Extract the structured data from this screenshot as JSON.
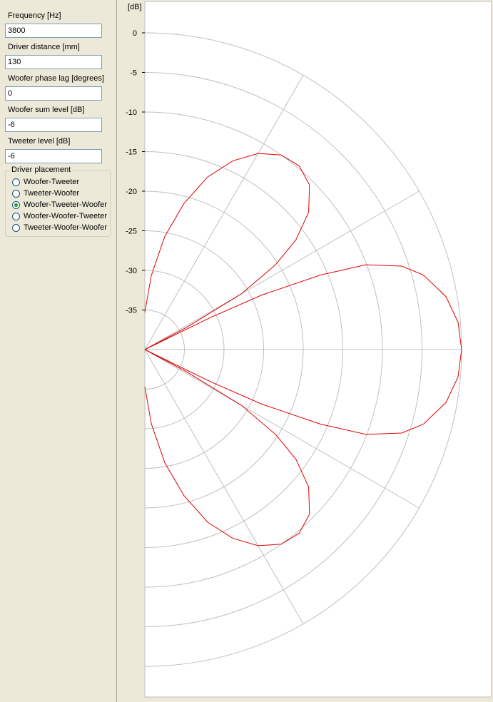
{
  "controls": {
    "frequency": {
      "label": "Frequency [Hz]",
      "value": "3800"
    },
    "driver_distance": {
      "label": "Driver distance [mm]",
      "value": "130"
    },
    "woofer_phase_lag": {
      "label": "Woofer phase lag [degrees]",
      "value": "0"
    },
    "woofer_sum_level": {
      "label": "Woofer sum level [dB]",
      "value": "-6"
    },
    "tweeter_level": {
      "label": "Tweeter level [dB]",
      "value": "-6"
    }
  },
  "driver_placement": {
    "title": "Driver placement",
    "options": [
      {
        "label": "Woofer-Tweeter",
        "checked": false
      },
      {
        "label": "Tweeter-Woofer",
        "checked": false
      },
      {
        "label": "Woofer-Tweeter-Woofer",
        "checked": true
      },
      {
        "label": "Woofer-Woofer-Tweeter",
        "checked": false
      },
      {
        "label": "Tweeter-Woofer-Woofer",
        "checked": false
      }
    ]
  },
  "colors": {
    "curve": "#e00000",
    "grid": "#c0c0c0",
    "panel": "#ece9d8"
  },
  "chart_data": {
    "type": "polar",
    "unit_label": "[dB]",
    "radial_ticks": [
      "0",
      "-5",
      "-10",
      "-15",
      "-20",
      "-25",
      "-30",
      "-35"
    ],
    "radial_range_db": [
      -40,
      0
    ],
    "angle_grid_deg": [
      -90,
      -60,
      -30,
      0,
      30,
      60,
      90
    ],
    "angle_range_deg": [
      -90,
      90
    ],
    "series": [
      {
        "points_deg_db": [
          [
            0,
            0
          ],
          [
            5,
            -0.3
          ],
          [
            10,
            -1.4
          ],
          [
            15,
            -3.6
          ],
          [
            18,
            -5.9
          ],
          [
            21,
            -10.1
          ],
          [
            23,
            -15.9
          ],
          [
            25,
            -23.7
          ],
          [
            26,
            -30.7
          ],
          [
            27,
            -40
          ],
          [
            27.5,
            -40
          ],
          [
            28,
            -34
          ],
          [
            30,
            -25.9
          ],
          [
            33,
            -20.3
          ],
          [
            36,
            -16.4
          ],
          [
            40,
            -13
          ],
          [
            45,
            -10.6
          ],
          [
            50,
            -9.7
          ],
          [
            55,
            -10
          ],
          [
            60,
            -11.4
          ],
          [
            65,
            -13.7
          ],
          [
            70,
            -16.8
          ],
          [
            75,
            -20.9
          ],
          [
            80,
            -25.5
          ],
          [
            85,
            -30.6
          ],
          [
            90,
            -35.3
          ]
        ]
      }
    ]
  }
}
